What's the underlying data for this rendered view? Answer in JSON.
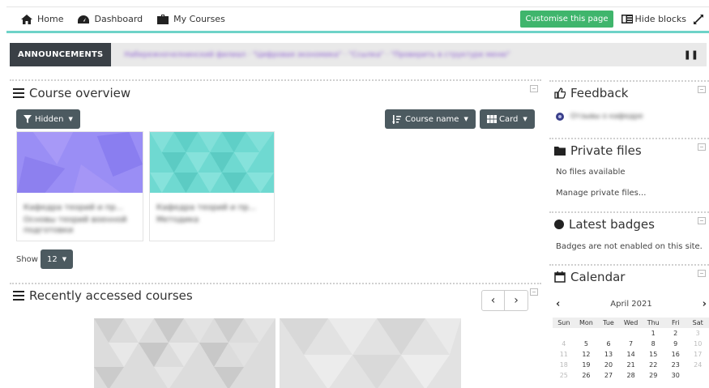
{
  "nav": {
    "home": "Home",
    "dashboard": "Dashboard",
    "my_courses": "My Courses",
    "customise": "Customise this page",
    "hide_blocks": "Hide blocks"
  },
  "announcements": {
    "label": "ANNOUNCEMENTS",
    "text": "Набережночелнинский филиал · \"Цифровая экономика\" · \"Ссылка\" · \"Проверить в структуре меню\""
  },
  "course_overview": {
    "title": "Course overview",
    "filter_label": "Hidden",
    "sort_label": "Course name",
    "view_label": "Card",
    "show_label": "Show",
    "show_value": "12",
    "cards": [
      {
        "line1": "Кафедра теорий и пр...",
        "line2": "Основы теорий военной",
        "line3": "подготовки"
      },
      {
        "line1": "Кафедра теорий и пр...",
        "line2": "Методика",
        "line3": ""
      }
    ]
  },
  "recent": {
    "title": "Recently accessed courses"
  },
  "feedback": {
    "title": "Feedback",
    "item": "Отзывы о кафедре"
  },
  "private_files": {
    "title": "Private files",
    "empty": "No files available",
    "manage": "Manage private files..."
  },
  "badges": {
    "title": "Latest badges",
    "text": "Badges are not enabled on this site."
  },
  "calendar": {
    "title": "Calendar",
    "month": "April 2021",
    "weekdays": [
      "Sun",
      "Mon",
      "Tue",
      "Wed",
      "Thu",
      "Fri",
      "Sat"
    ],
    "weeks": [
      [
        "",
        "",
        "",
        "",
        "1",
        "2",
        "3"
      ],
      [
        "4",
        "5",
        "6",
        "7",
        "8",
        "9",
        "10"
      ],
      [
        "11",
        "12",
        "13",
        "14",
        "15",
        "16",
        "17"
      ],
      [
        "18",
        "19",
        "20",
        "21",
        "22",
        "23",
        "24"
      ],
      [
        "25",
        "26",
        "27",
        "28",
        "29",
        "30",
        ""
      ]
    ]
  },
  "colors": {
    "accent": "#6ed3c8",
    "customise_bg": "#3fb56c",
    "dark_button": "#4c5a60",
    "card1": "#9a8ef5",
    "card2": "#6fd9d1"
  }
}
